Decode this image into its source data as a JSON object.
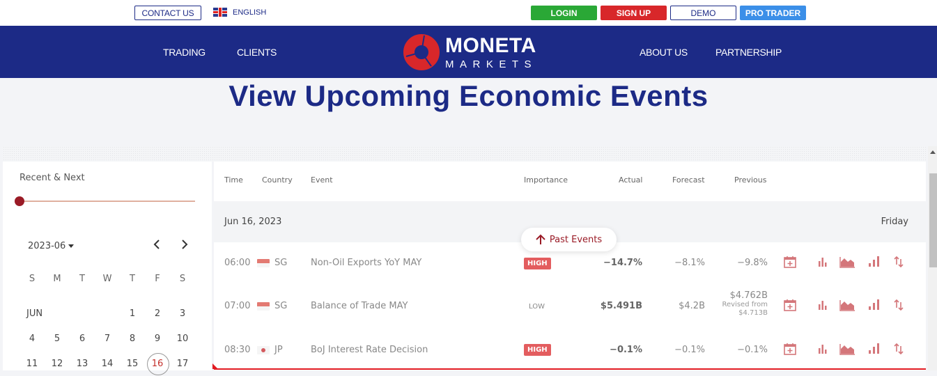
{
  "topbar": {
    "contact_label": "CONTACT US",
    "language_label": "ENGLISH",
    "language_icon": "uk-flag-icon",
    "login_label": "LOGIN",
    "signup_label": "SIGN UP",
    "demo_label": "DEMO",
    "pro_trader_label": "PRO TRADER",
    "colors": {
      "login": "#2aa836",
      "signup": "#d8272a",
      "demo_border": "#1c2a86",
      "pro_trader": "#3b8fe8"
    }
  },
  "navbar": {
    "background": "#1c2a86",
    "links": [
      {
        "label": "TRADING"
      },
      {
        "label": "CLIENTS"
      },
      {
        "label": "ABOUT US"
      },
      {
        "label": "PARTNERSHIP"
      }
    ],
    "logo": {
      "line1": "MONETA",
      "line2": "MARKETS",
      "accent": "#d8272a"
    }
  },
  "page": {
    "title": "View Upcoming Economic Events"
  },
  "sidebar": {
    "range_label": "Recent & Next",
    "range_slider_value": 0,
    "calendar": {
      "month_select": "2023-06",
      "prev_icon": "chevron-left-icon",
      "next_icon": "chevron-right-icon",
      "weekdays": [
        "S",
        "M",
        "T",
        "W",
        "T",
        "F",
        "S"
      ],
      "month_label": "JUN",
      "weeks": [
        [
          "JUN",
          "",
          "",
          "",
          "1",
          "2",
          "3"
        ],
        [
          "4",
          "5",
          "6",
          "7",
          "8",
          "9",
          "10"
        ],
        [
          "11",
          "12",
          "13",
          "14",
          "15",
          "16",
          "17"
        ]
      ],
      "selected_day": "16"
    }
  },
  "events": {
    "columns": {
      "time": "Time",
      "country": "Country",
      "event": "Event",
      "importance": "Importance",
      "actual": "Actual",
      "forecast": "Forecast",
      "previous": "Previous"
    },
    "date_header": {
      "date": "Jun 16, 2023",
      "weekday": "Friday"
    },
    "past_events_label": "Past Events",
    "rows": [
      {
        "time": "06:00",
        "country": "SG",
        "flag": "sg-flag-icon",
        "event": "Non-Oil Exports YoY MAY",
        "importance": "HIGH",
        "actual": "−14.7%",
        "forecast": "−8.1%",
        "previous": "−9.8%",
        "revised_label": "",
        "revised_value": ""
      },
      {
        "time": "07:00",
        "country": "SG",
        "flag": "sg-flag-icon",
        "event": "Balance of Trade MAY",
        "importance": "LOW",
        "actual": "$5.491B",
        "forecast": "$4.2B",
        "previous": "$4.762B",
        "revised_label": "Revised from",
        "revised_value": "$4.713B"
      },
      {
        "time": "08:30",
        "country": "JP",
        "flag": "jp-flag-icon",
        "event": "BoJ Interest Rate Decision",
        "importance": "HIGH",
        "actual": "−0.1%",
        "forecast": "−0.1%",
        "previous": "−0.1%",
        "revised_label": "",
        "revised_value": ""
      }
    ],
    "row_actions": [
      "add-to-calendar-icon",
      "bar-chart-icon",
      "area-chart-icon",
      "signal-chart-icon",
      "sort-arrows-icon"
    ],
    "accent_color": "#d4767a"
  }
}
